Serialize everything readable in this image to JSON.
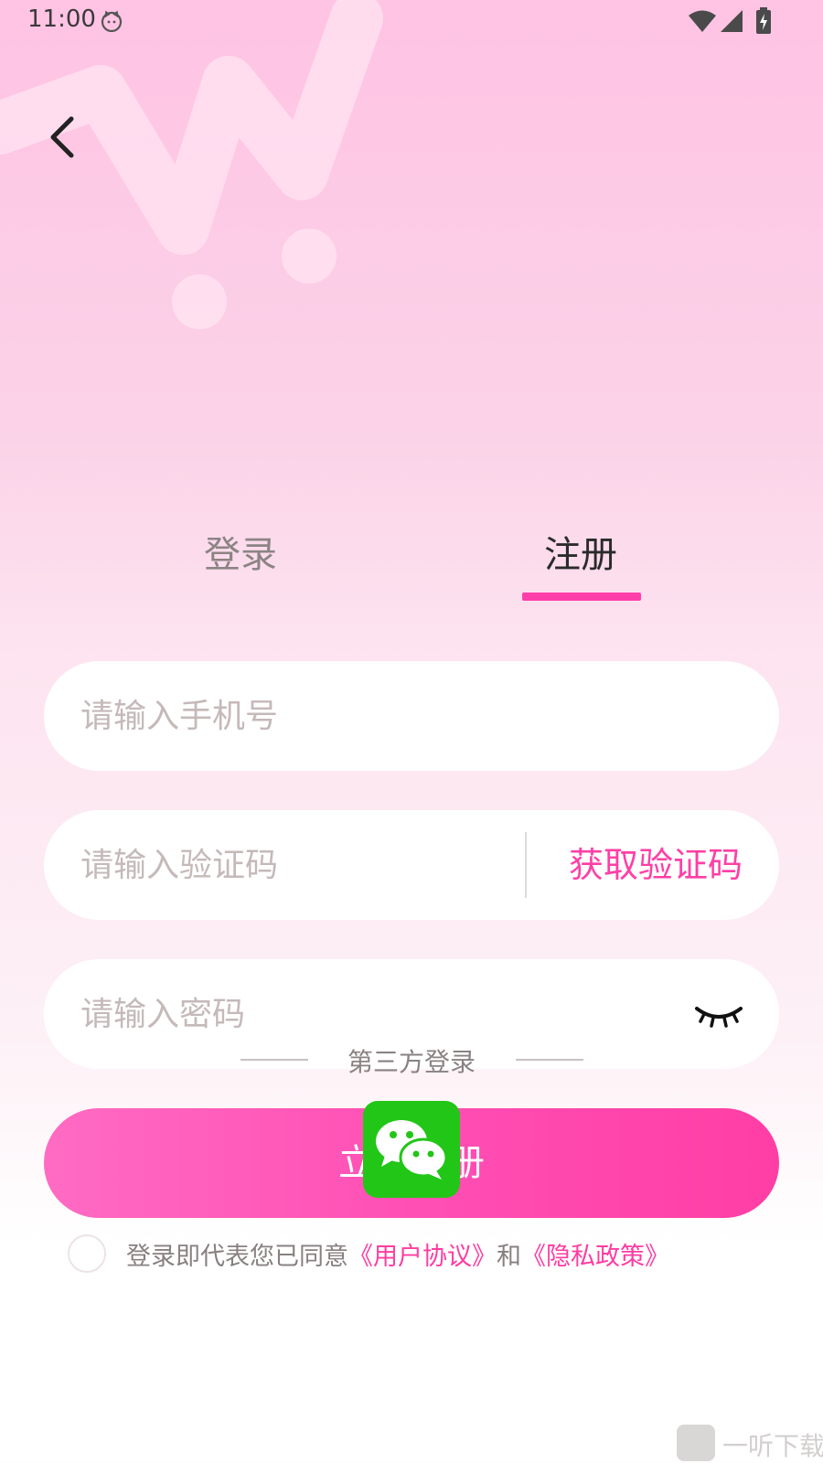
{
  "status_bar": {
    "time": "11:00"
  },
  "icons": {
    "back": "chevron-left-icon",
    "wifi": "wifi-icon",
    "signal": "signal-icon",
    "battery": "battery-charging-icon",
    "eye": "eye-closed-icon",
    "wechat": "wechat-icon"
  },
  "tabs": [
    {
      "label": "登录",
      "active": false
    },
    {
      "label": "注册",
      "active": true
    }
  ],
  "form": {
    "phone_placeholder": "请输入手机号",
    "code_placeholder": "请输入验证码",
    "get_code_label": "获取验证码",
    "password_placeholder": "请输入密码",
    "submit_label": "立即注册"
  },
  "third_party": {
    "label": "第三方登录"
  },
  "agreement": {
    "prefix": "登录即代表您已同意",
    "user_agreement": "《用户协议》",
    "and": "和",
    "privacy_policy": "《隐私政策》"
  },
  "watermark": {
    "text": "一听下载"
  },
  "colors": {
    "accent": "#ff3eaa",
    "wechat_green": "#22c617"
  }
}
